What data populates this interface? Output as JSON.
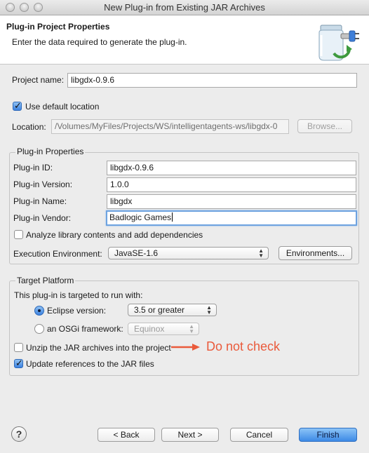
{
  "window": {
    "title": "New Plug-in from Existing JAR Archives"
  },
  "header": {
    "title": "Plug-in Project Properties",
    "description": "Enter the data required to generate the plug-in.",
    "icon": "jar-plugin-icon"
  },
  "project": {
    "name_label": "Project name:",
    "name_value": "libgdx-0.9.6",
    "use_default_label": "Use default location",
    "use_default_checked": true,
    "location_label": "Location:",
    "location_value": "/Volumes/MyFiles/Projects/WS/intelligentagents-ws/libgdx-0",
    "browse_label": "Browse..."
  },
  "plugin_properties": {
    "group_label": "Plug-in Properties",
    "id_label": "Plug-in ID:",
    "id_value": "libgdx-0.9.6",
    "version_label": "Plug-in Version:",
    "version_value": "1.0.0",
    "name_label": "Plug-in Name:",
    "name_value": "libgdx",
    "vendor_label": "Plug-in Vendor:",
    "vendor_value": "Badlogic Games",
    "analyze_label": "Analyze library contents and add dependencies",
    "analyze_checked": false,
    "exec_env_label": "Execution Environment:",
    "exec_env_value": "JavaSE-1.6",
    "environments_label": "Environments..."
  },
  "target_platform": {
    "group_label": "Target Platform",
    "intro": "This plug-in is targeted to run with:",
    "eclipse_label": "Eclipse version:",
    "eclipse_selected": true,
    "eclipse_value": "3.5 or greater",
    "osgi_label": "an OSGi framework:",
    "osgi_value": "Equinox"
  },
  "options": {
    "unzip_label": "Unzip the JAR archives into the project",
    "unzip_checked": false,
    "update_refs_label": "Update references to the JAR files",
    "update_refs_checked": true
  },
  "annotation": {
    "text": "Do not check",
    "color": "#ea5a3b"
  },
  "footer": {
    "back_label": "< Back",
    "next_label": "Next >",
    "cancel_label": "Cancel",
    "finish_label": "Finish"
  }
}
